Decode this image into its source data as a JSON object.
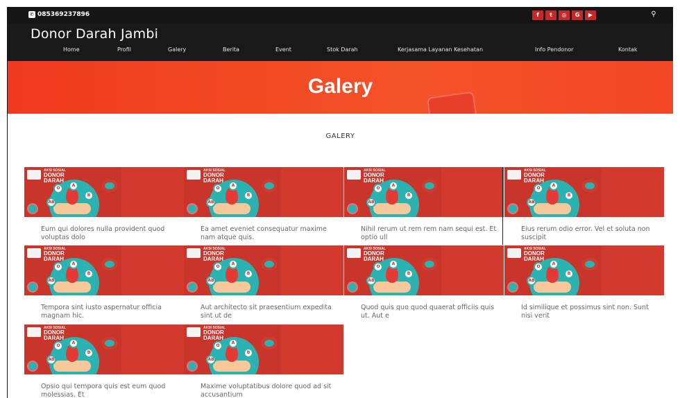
{
  "topbar": {
    "phone": "085369237896",
    "socials": [
      {
        "icon": "facebook-icon",
        "glyph": "f"
      },
      {
        "icon": "twitter-icon",
        "glyph": "t"
      },
      {
        "icon": "instagram-icon",
        "glyph": "◎"
      },
      {
        "icon": "google-icon",
        "glyph": "G"
      },
      {
        "icon": "youtube-icon",
        "glyph": "▶"
      }
    ],
    "search_glyph": "⚲"
  },
  "header": {
    "brand": "Donor Darah Jambi",
    "nav": [
      "Home",
      "Profil",
      "Galery",
      "Berita",
      "Event",
      "Stok Darah",
      "Kerjasama Layanan Kesehatan",
      "Info Pendonor",
      "Kontak"
    ]
  },
  "hero": {
    "title": "Galery"
  },
  "section": {
    "title": "GALERY"
  },
  "card_art": {
    "small": "AKSI SOSIAL",
    "big1": "DONOR",
    "big2": "DARAH",
    "labels": [
      "O",
      "A",
      "B",
      "AB"
    ]
  },
  "gallery": [
    {
      "caption": "Eum qui dolores nulla provident quod voluptas dolo"
    },
    {
      "caption": "Ea amet eveniet consequatur maxime nam atque quis."
    },
    {
      "caption": "Nihil rerum ut rem rem nam sequi est. Et optio ull"
    },
    {
      "caption": "Eius rerum odio error. Vel et soluta non suscipit"
    },
    {
      "caption": "Tempora sint iusto aspernatur officia magnam hic."
    },
    {
      "caption": "Aut architecto sit praesentium expedita sint ut de"
    },
    {
      "caption": "Quod quis quo quod quaerat officiis quis ut. Aut e"
    },
    {
      "caption": "Id similique et possimus sint non. Sunt nisi verit"
    },
    {
      "caption": "Opsio qui tempora quis est eum quod molessias. Et"
    },
    {
      "caption": "Maxime voluptatibus dolore quod ad sit accusantium"
    }
  ],
  "colors": {
    "topbar": "#151515",
    "header": "#191919",
    "hero": "#ef3a1f",
    "accent": "#c62828",
    "teal": "#2bb3b1"
  }
}
